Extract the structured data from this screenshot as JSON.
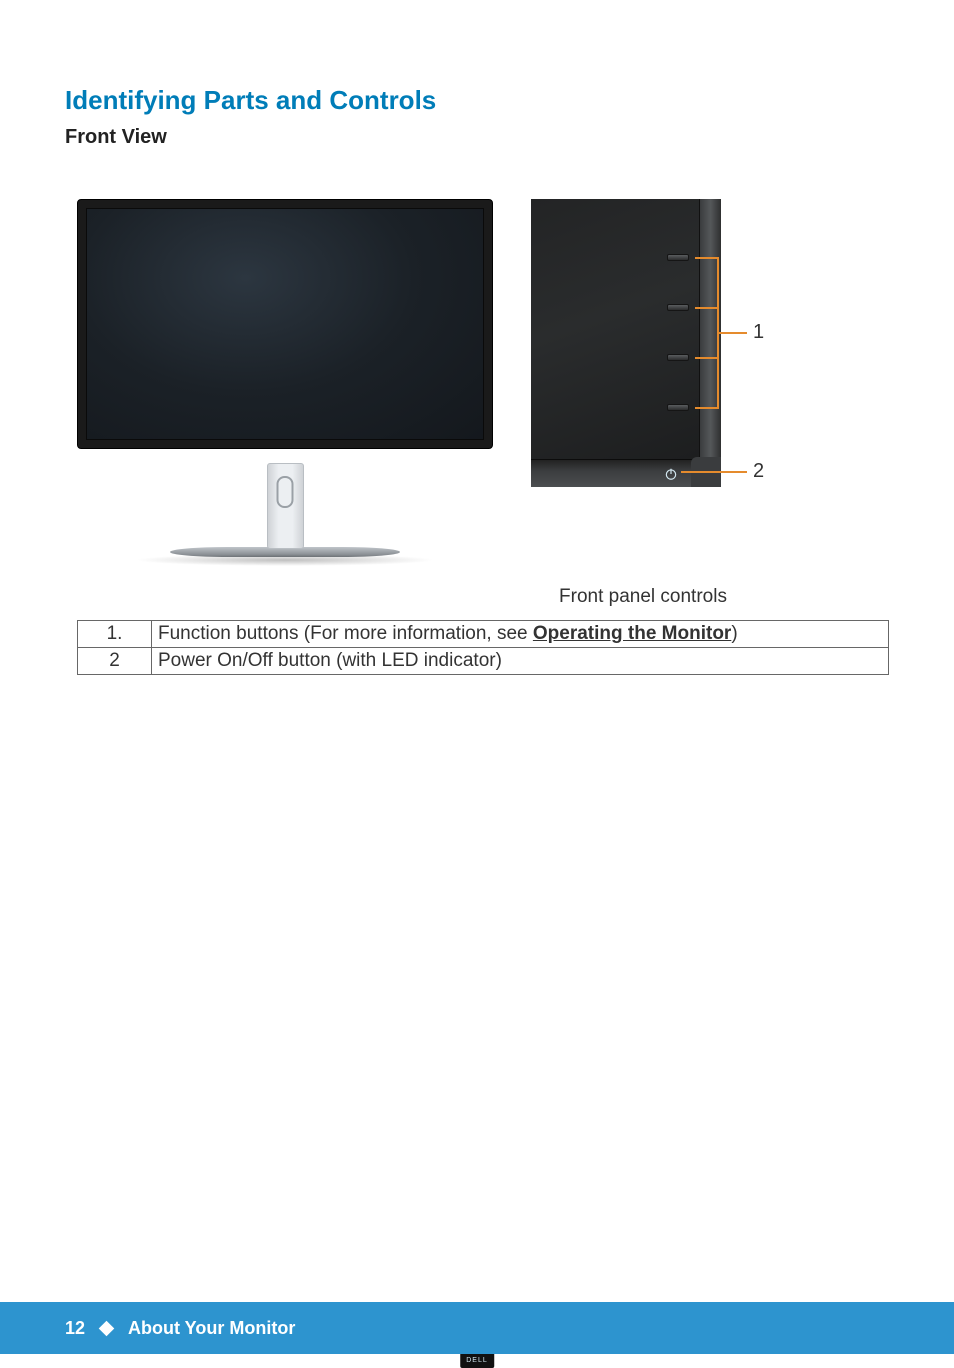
{
  "heading": "Identifying Parts and Controls",
  "subheading": "Front View",
  "monitor_logo": "DELL",
  "caption": "Front panel controls",
  "callout_labels": {
    "one": "1",
    "two": "2"
  },
  "table": {
    "rows": [
      {
        "num": "1.",
        "desc_prefix": "Function buttons (For more information, see ",
        "desc_link": "Operating the Monitor",
        "desc_suffix": ")"
      },
      {
        "num": "2",
        "desc": "Power On/Off button (with LED indicator)"
      }
    ]
  },
  "footer": {
    "page": "12",
    "section": "About Your Monitor"
  }
}
